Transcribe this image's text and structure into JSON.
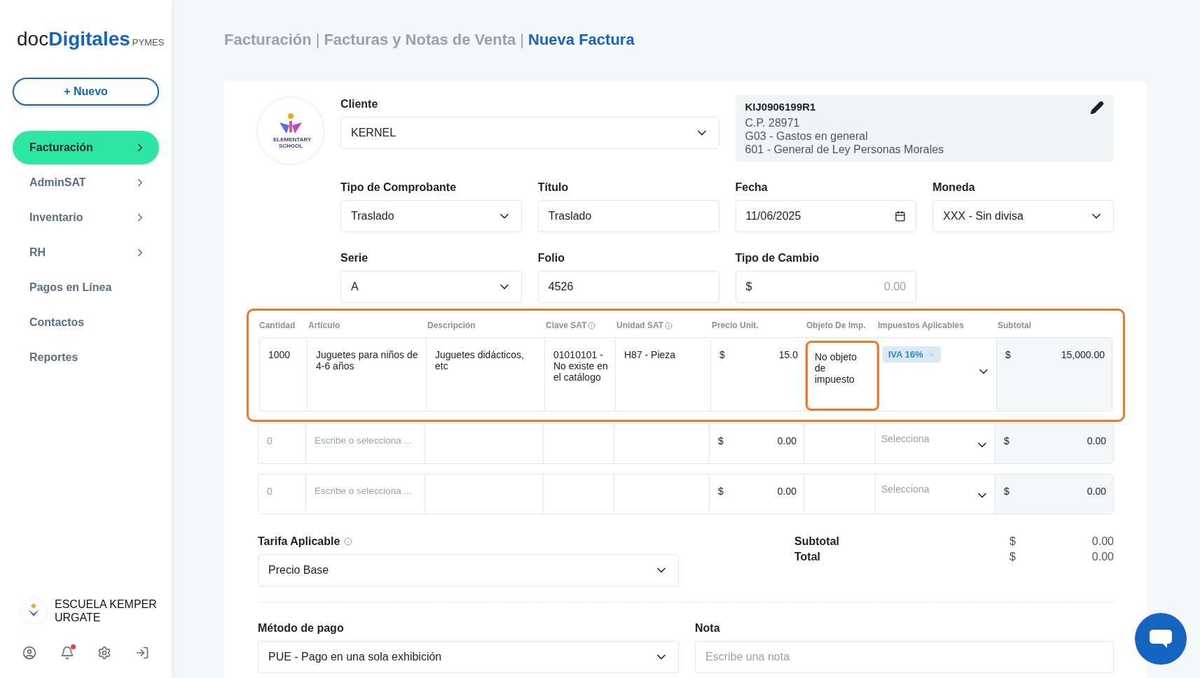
{
  "sidebar": {
    "logo": {
      "prefix": "doc",
      "main": "Digitales",
      "suffix": "PYMES"
    },
    "new_button": "+ Nuevo",
    "items": [
      {
        "label": "Facturación",
        "selected": true,
        "expandable": true
      },
      {
        "label": "AdminSAT",
        "selected": false,
        "expandable": true
      },
      {
        "label": "Inventario",
        "selected": false,
        "expandable": true
      },
      {
        "label": "RH",
        "selected": false,
        "expandable": true
      },
      {
        "label": "Pagos en Línea",
        "selected": false,
        "expandable": false
      },
      {
        "label": "Contactos",
        "selected": false,
        "expandable": false
      },
      {
        "label": "Reportes",
        "selected": false,
        "expandable": false
      }
    ],
    "user": {
      "name": "ESCUELA KEMPER URGATE"
    },
    "notifications_unread": true
  },
  "breadcrumb": {
    "separator": "|",
    "items": [
      "Facturación",
      "Facturas y Notas de Venta",
      "Nueva Factura"
    ]
  },
  "client": {
    "logo_text": "ELEMENTARY SCHOOL",
    "label": "Cliente",
    "value": "KERNEL",
    "info": {
      "rfc": "KIJ0906199R1",
      "lines": [
        "C.P. 28971",
        "G03 - Gastos en general",
        "601 - General de Ley Personas Morales"
      ]
    }
  },
  "fields": [
    {
      "kind": "select",
      "label": "Tipo de Comprobante",
      "value": "Traslado"
    },
    {
      "kind": "text",
      "label": "Título",
      "value": "Traslado"
    },
    {
      "kind": "date",
      "label": "Fecha",
      "value": "11/06/2025"
    },
    {
      "kind": "select",
      "label": "Moneda",
      "value": "XXX - Sin divisa"
    },
    {
      "kind": "select",
      "label": "Serie",
      "value": "A"
    },
    {
      "kind": "text",
      "label": "Folio",
      "value": "4526"
    },
    {
      "kind": "currency",
      "label": "Tipo de Cambio",
      "prefix": "$",
      "placeholder": "0.00"
    }
  ],
  "table": {
    "columns": [
      {
        "label": "Cantidad",
        "info": false
      },
      {
        "label": "Artículo",
        "info": false
      },
      {
        "label": "Descripción",
        "info": false
      },
      {
        "label": "Clave SAT",
        "info": true
      },
      {
        "label": "Unidad SAT",
        "info": true
      },
      {
        "label": "Precio Unit.",
        "info": false
      },
      {
        "label": "Objeto De Imp.",
        "info": false
      },
      {
        "label": "Impuestos Aplicables",
        "info": false
      },
      {
        "label": "Subtotal",
        "info": false
      }
    ],
    "rows": [
      {
        "highlighted": true,
        "cantidad": "1000",
        "articulo": "Juguetes para niños de 4-6 años",
        "descripcion": "Juguetes didácticos, etc",
        "clave_sat": "01010101 - No existe en el catálogo",
        "unidad_sat": "H87 - Pieza",
        "precio_currency": "$",
        "precio": "15.0",
        "objeto_imp": "No objeto de impuesto",
        "objeto_highlighted": true,
        "impuestos": [
          "IVA 16%"
        ],
        "subtotal_currency": "$",
        "subtotal": "15,000.00"
      },
      {
        "cantidad_placeholder": "0",
        "articulo_placeholder": "Escribe o selecciona ...",
        "precio_currency": "$",
        "precio": "0.00",
        "impuestos_placeholder": "Selecciona",
        "subtotal_currency": "$",
        "subtotal": "0.00"
      },
      {
        "cantidad_placeholder": "0",
        "articulo_placeholder": "Escribe o selecciona ...",
        "precio_currency": "$",
        "precio": "0.00",
        "impuestos_placeholder": "Selecciona",
        "subtotal_currency": "$",
        "subtotal": "0.00"
      }
    ]
  },
  "tarifa": {
    "label": "Tarifa Aplicable",
    "info": true,
    "value": "Precio Base"
  },
  "totals": [
    {
      "label": "Subtotal",
      "currency": "$",
      "value": "0.00"
    },
    {
      "label": "Total",
      "currency": "$",
      "value": "0.00"
    }
  ],
  "metodo_pago": {
    "label": "Método de pago",
    "value": "PUE - Pago en una sola exhibición"
  },
  "nota": {
    "label": "Nota",
    "placeholder": "Escribe una nota"
  }
}
